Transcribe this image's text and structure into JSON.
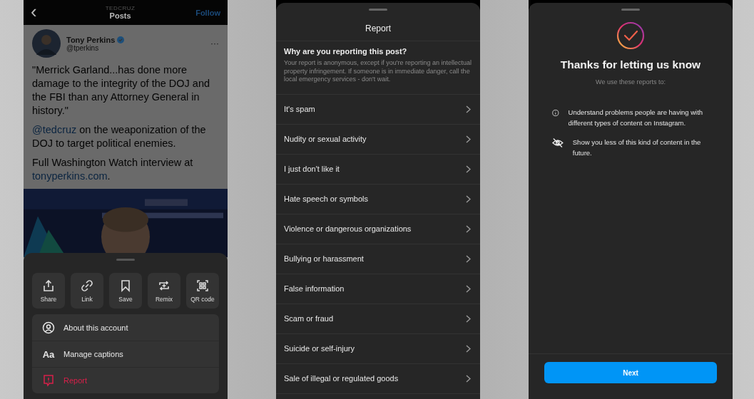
{
  "post_screen": {
    "header": {
      "back": "‹",
      "account": "TEDCRUZ",
      "title": "Posts",
      "follow": "Follow"
    },
    "post": {
      "author": "Tony Perkins",
      "verified": true,
      "handle": "@tperkins",
      "more": "···",
      "paragraphs": [
        {
          "parts": [
            {
              "text": "\"Merrick Garland...has done more damage to the integrity of the DOJ and the FBI than any Attorney General in history.\"",
              "link": false
            }
          ]
        },
        {
          "parts": [
            {
              "text": "@tedcruz",
              "link": true
            },
            {
              "text": " on the weaponization of the DOJ to target political enemies.",
              "link": false
            }
          ]
        },
        {
          "parts": [
            {
              "text": "Full Washington Watch interview at ",
              "link": false
            },
            {
              "text": "tonyperkins.com",
              "link": true
            },
            {
              "text": ".",
              "link": false
            }
          ]
        }
      ]
    },
    "sheet": {
      "actions": [
        {
          "kind": "share",
          "label": "Share"
        },
        {
          "kind": "link",
          "label": "Link"
        },
        {
          "kind": "save",
          "label": "Save"
        },
        {
          "kind": "remix",
          "label": "Remix"
        },
        {
          "kind": "qr",
          "label": "QR code"
        }
      ],
      "menu": [
        {
          "kind": "account",
          "label": "About this account",
          "danger": false
        },
        {
          "kind": "captions",
          "icon_text": "Aa",
          "label": "Manage captions",
          "danger": false
        },
        {
          "kind": "report",
          "label": "Report",
          "danger": true
        }
      ]
    }
  },
  "report_screen": {
    "title": "Report",
    "question": "Why are you reporting this post?",
    "note": "Your report is anonymous, except if you're reporting an intellectual property infringement. If someone is in immediate danger, call the local emergency services - don't wait.",
    "reasons": [
      "It's spam",
      "Nudity or sexual activity",
      "I just don't like it",
      "Hate speech or symbols",
      "Violence or dangerous organizations",
      "Bullying or harassment",
      "False information",
      "Scam or fraud",
      "Suicide or self-injury",
      "Sale of illegal or regulated goods"
    ]
  },
  "thanks_screen": {
    "title": "Thanks for letting us know",
    "subtitle": "We use these reports to:",
    "points": [
      {
        "kind": "info",
        "text": "Understand problems people are having with different types of content on Instagram."
      },
      {
        "kind": "hide",
        "text": "Show you less of this kind of content in the future."
      }
    ],
    "button": "Next"
  }
}
